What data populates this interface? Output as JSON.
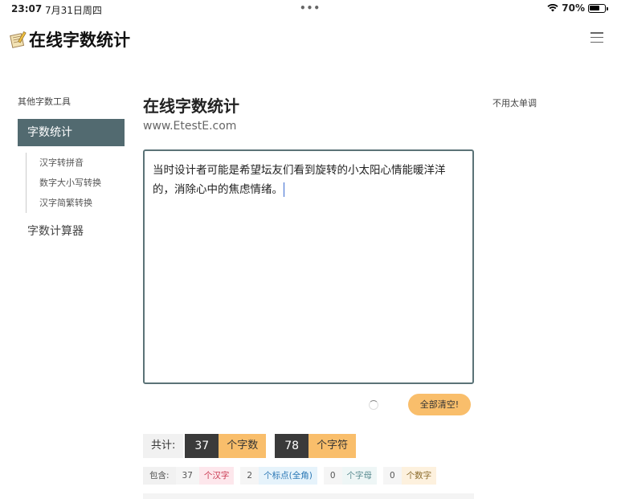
{
  "status": {
    "time": "23:07",
    "date": "7月31日周四",
    "battery": "70%",
    "battery_level": 0.7
  },
  "header": {
    "logo_text": "在线字数统计",
    "menu_icon": "hamburger-icon"
  },
  "sidebar": {
    "title": "其他字数工具",
    "active_item": "字数统计",
    "sub_items": [
      "汉字转拼音",
      "数字大小写转换",
      "汉字简繁转换"
    ],
    "other_item": "字数计算器"
  },
  "main": {
    "title": "在线字数统计",
    "url": "www.EtestE.com",
    "text_line1": "当时设计者可能是希望坛友们看到旋转的小太阳心情能暖洋洋",
    "text_line2": "的，消除心中的焦虑情绪。",
    "clear_button": "全部清空!"
  },
  "totals": {
    "label": "共计:",
    "char_count": "37",
    "char_unit": "个字数",
    "symbol_count": "78",
    "symbol_unit": "个字符"
  },
  "contains": {
    "label": "包含:",
    "hanzi_count": "37",
    "hanzi_unit": "个汉字",
    "punct_count": "2",
    "punct_unit": "个标点(全角)",
    "letter_count": "0",
    "letter_unit": "个字母",
    "digit_count": "0",
    "digit_unit": "个数字"
  },
  "right_col": {
    "text": "不用太单调"
  },
  "colors": {
    "accent_dark": "#526a70",
    "orange": "#f9be6b"
  }
}
